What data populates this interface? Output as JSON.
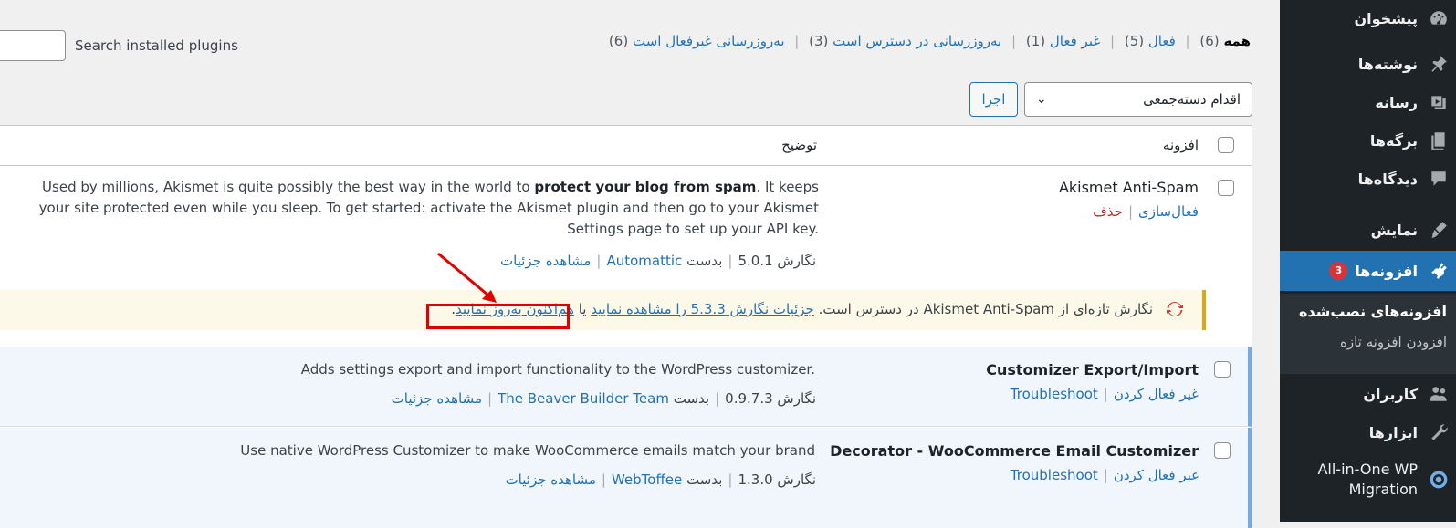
{
  "sidebar": {
    "items": [
      {
        "label": "پیشخوان",
        "icon": "dashboard-icon"
      },
      {
        "label": "نوشته‌ها",
        "icon": "pin-icon"
      },
      {
        "label": "رسانه",
        "icon": "media-icon"
      },
      {
        "label": "برگه‌ها",
        "icon": "pages-icon"
      },
      {
        "label": "دیدگاه‌ها",
        "icon": "comments-icon"
      },
      {
        "label": "نمایش",
        "icon": "appearance-icon"
      },
      {
        "label": "افزونه‌ها",
        "icon": "plugins-icon",
        "badge": "3"
      },
      {
        "label": "کاربران",
        "icon": "users-icon"
      },
      {
        "label": "ابزارها",
        "icon": "tools-icon"
      },
      {
        "label": "All-in-One WP Migration",
        "icon": "migration-icon"
      }
    ],
    "submenu": {
      "installed": "افزونه‌های نصب‌شده",
      "add_new": "افزودن افزونه تازه"
    }
  },
  "search": {
    "label": "Search installed plugins",
    "value": ""
  },
  "filters": {
    "all": "همه",
    "all_count": "(6)",
    "active": "فعال",
    "active_count": "(5)",
    "inactive": "غیر فعال",
    "inactive_count": "(1)",
    "update": "به‌روزرسانی در دسترس است",
    "update_count": "(3)",
    "auto_disabled": "به‌روزرسانی غیرفعال است",
    "auto_disabled_count": "(6)"
  },
  "bulk": {
    "selected": "اقدام دسته‌جمعی",
    "apply": "اجرا"
  },
  "table": {
    "col_plugin": "افزونه",
    "col_desc": "توضیح"
  },
  "plugins": [
    {
      "name": "Akismet Anti-Spam",
      "action1": "فعال‌سازی",
      "action2": "حذف",
      "desc_pre": "Used by millions, Akismet is quite possibly the best way in the world to ",
      "desc_bold": "protect your blog from spam",
      "desc_post": ". It keeps your site protected even while you sleep. To get started: activate the Akismet plugin and then go to your Akismet Settings page to set up your API key.",
      "version": "نگارش 5.0.1",
      "by": "بدست",
      "author": "Automattic",
      "details": "مشاهده جزئیات"
    },
    {
      "name": "Customizer Export/Import",
      "action1": "غیر فعال کردن",
      "action2": "Troubleshoot",
      "desc": "Adds settings export and import functionality to the WordPress customizer.",
      "version": "نگارش 0.9.7.3",
      "by": "بدست",
      "author": "The Beaver Builder Team",
      "details": "مشاهده جزئیات"
    },
    {
      "name": "Decorator - WooCommerce Email Customizer",
      "action1": "غیر فعال کردن",
      "action2": "Troubleshoot",
      "desc": "Use native WordPress Customizer to make WooCommerce emails match your brand",
      "version": "نگارش 1.3.0",
      "by": "بدست",
      "author": "WebToffee",
      "details": "مشاهده جزئیات"
    }
  ],
  "update_notice": {
    "text1": "نگارش تازه‌ای از Akismet Anti-Spam در دسترس است.",
    "link1": "جزئیات نگارش 5.3.3 را مشاهده نمایید",
    "text2": "یا",
    "link2": "هم‌اکنون به‌روز نمایید",
    "end": "."
  },
  "colors": {
    "accent": "#2271b1",
    "sidebar_bg": "#1d2327",
    "notice_border": "#dba617",
    "badge": "#d63638",
    "annotation": "#e00000"
  }
}
